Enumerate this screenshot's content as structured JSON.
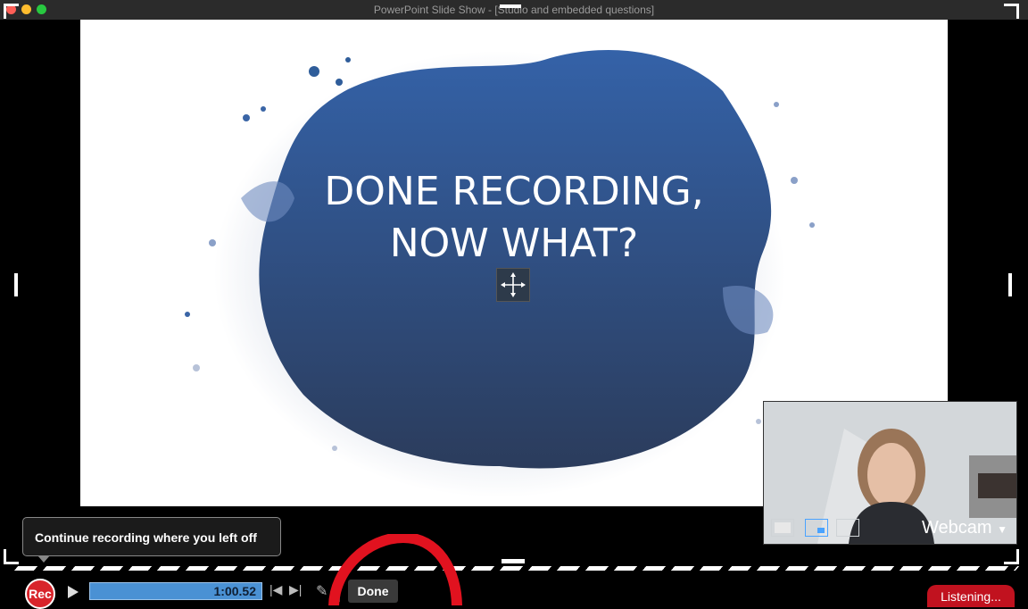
{
  "window": {
    "title": "PowerPoint Slide Show - [Studio and embedded questions]"
  },
  "slide": {
    "title_line1": "DONE RECORDING,",
    "title_line2": "NOW WHAT?"
  },
  "webcam": {
    "label": "Webcam",
    "views": [
      "fullscreen-view",
      "picture-in-picture-view",
      "side-by-side-view"
    ],
    "selected_view": "picture-in-picture-view"
  },
  "tooltip": {
    "text": "Continue recording where you left off"
  },
  "toolbar": {
    "rec_label": "Rec",
    "time": "1:00.52",
    "done_label": "Done"
  },
  "status": {
    "listening": "Listening..."
  },
  "colors": {
    "rec_red": "#d8242b",
    "timeline_blue": "#4a91d4",
    "slide_blue": "#2f5d9a",
    "listening_red": "#c1121f"
  }
}
